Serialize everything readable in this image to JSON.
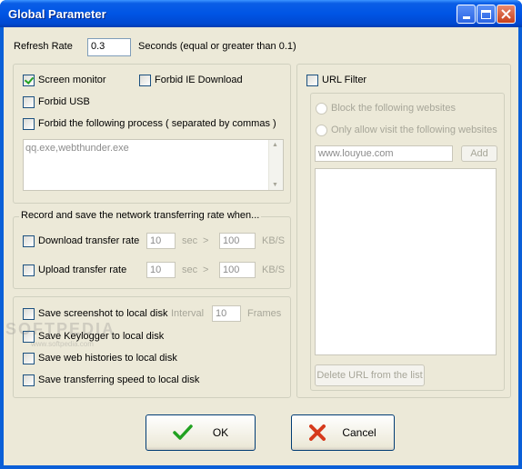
{
  "window": {
    "title": "Global Parameter",
    "controls": [
      "minimize",
      "maximize",
      "close"
    ]
  },
  "refresh": {
    "label": "Refresh Rate",
    "value": "0.3",
    "hint": "Seconds (equal or greater than 0.1)"
  },
  "monitor": {
    "screen_monitor": {
      "label": "Screen monitor",
      "checked": true
    },
    "forbid_ie": {
      "label": "Forbid IE Download",
      "checked": false
    },
    "forbid_usb": {
      "label": "Forbid USB",
      "checked": false
    },
    "forbid_process": {
      "label": "Forbid the following process ( separated by commas )",
      "checked": false
    },
    "process_list": "qq.exe,webthunder.exe"
  },
  "network": {
    "group_title": "Record and save the network transferring rate when...",
    "download": {
      "label": "Download transfer rate",
      "min": "10",
      "sec_label": "sec",
      "gt": ">",
      "threshold": "100",
      "unit": "KB/S"
    },
    "upload": {
      "label": "Upload transfer rate",
      "min": "10",
      "sec_label": "sec",
      "gt": ">",
      "threshold": "100",
      "unit": "KB/S"
    }
  },
  "save": {
    "screenshot": {
      "label": "Save screenshot to local disk",
      "interval_label": "Interval",
      "interval": "10",
      "frames_label": "Frames"
    },
    "keylogger": {
      "label": "Save Keylogger to local disk"
    },
    "web_history": {
      "label": "Save web histories to local disk"
    },
    "speed": {
      "label": "Save transferring speed to local disk"
    }
  },
  "url_filter": {
    "label": "URL Filter",
    "block_label": "Block the following websites",
    "allow_label": "Only allow visit the following websites",
    "url_value": "www.louyue.com",
    "add_label": "Add",
    "delete_label": "Delete URL from the list"
  },
  "buttons": {
    "ok": "OK",
    "cancel": "Cancel"
  },
  "watermark": {
    "logo": "SOFTPEDIA",
    "url": "www.softpedia.com"
  },
  "colors": {
    "titlebar": "#0055e5",
    "dialog_bg": "#ece9d8",
    "ok_check": "#21a121",
    "cancel_x": "#d63a1c"
  }
}
